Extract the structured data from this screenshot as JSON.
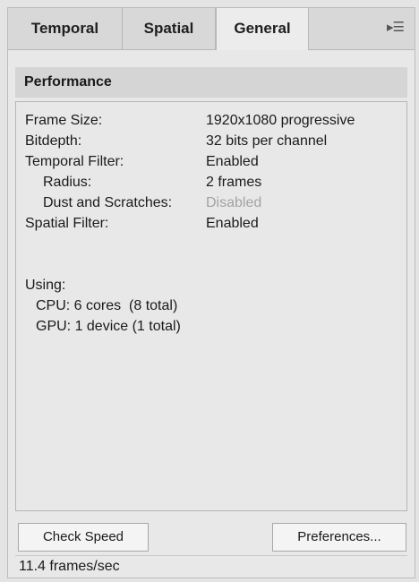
{
  "tabs": [
    {
      "label": "Temporal"
    },
    {
      "label": "Spatial"
    },
    {
      "label": "General",
      "selected": true
    }
  ],
  "panel_menu_icon": "▸☰",
  "section": {
    "title": "Performance"
  },
  "info": {
    "frame_size_label": "Frame Size:",
    "frame_size_value": "1920x1080 progressive",
    "bitdepth_label": "Bitdepth:",
    "bitdepth_value": "32 bits per channel",
    "temporal_filter_label": "Temporal Filter:",
    "temporal_filter_value": "Enabled",
    "radius_label": "Radius:",
    "radius_value": "2 frames",
    "dust_label": "Dust and Scratches:",
    "dust_value": "Disabled",
    "spatial_filter_label": "Spatial Filter:",
    "spatial_filter_value": "Enabled",
    "using_label": "Using:",
    "cpu_line": "CPU: 6 cores  (8 total)",
    "gpu_line": "GPU: 1 device (1 total)"
  },
  "buttons": {
    "check_speed": "Check Speed",
    "preferences": "Preferences..."
  },
  "status": {
    "text": "11.4 frames/sec"
  },
  "colors": {
    "panel_bg": "#e8e8e8",
    "header_bg": "#d5d5d5",
    "disabled_text": "#a3a3a3"
  }
}
